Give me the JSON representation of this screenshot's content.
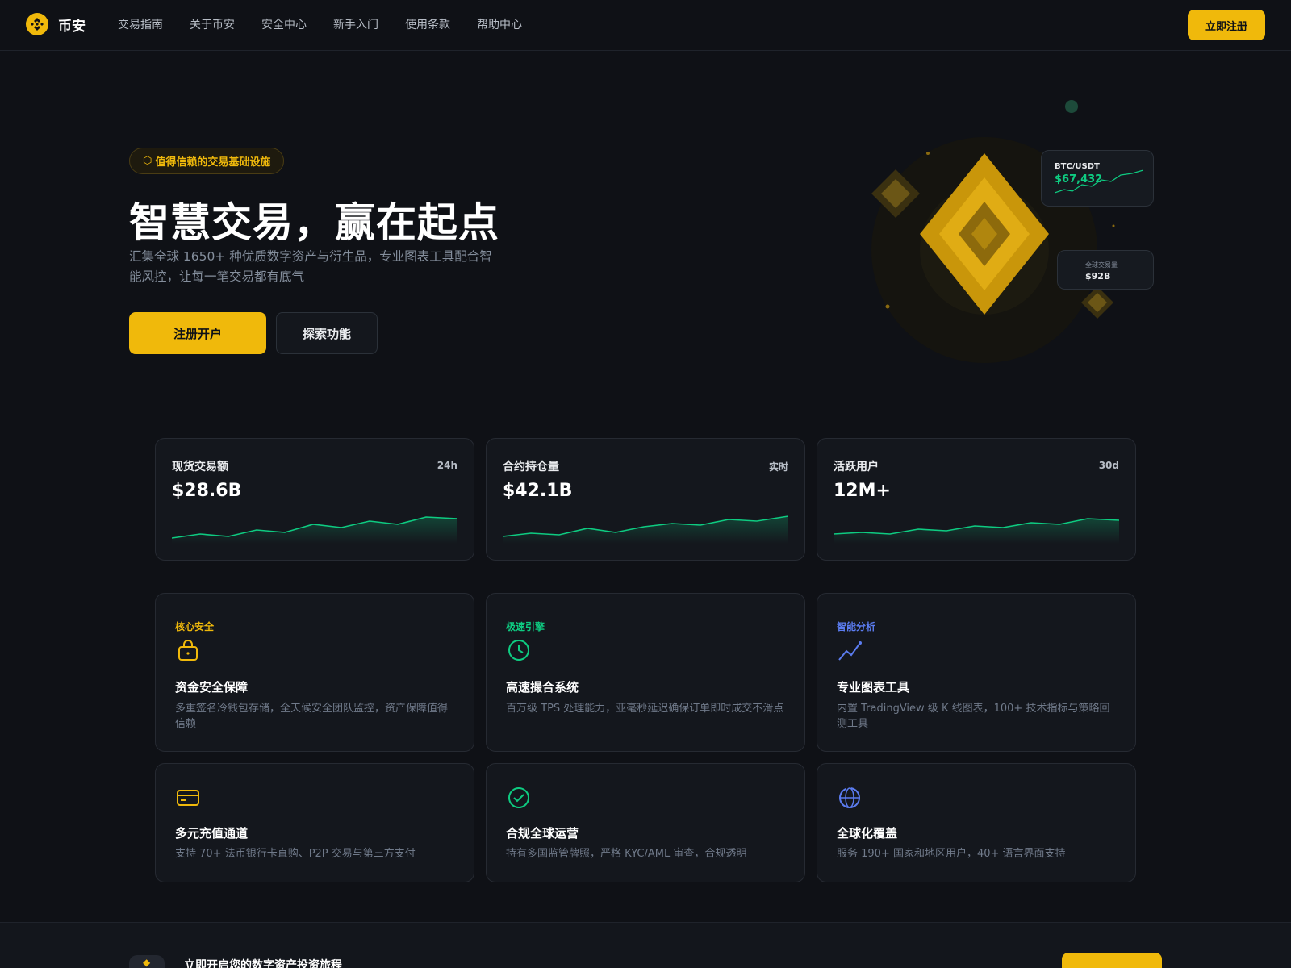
{
  "nav": {
    "brand": "币安",
    "links": [
      "交易指南",
      "关于币安",
      "安全中心",
      "新手入门",
      "使用条款",
      "帮助中心"
    ],
    "cta": "立即注册"
  },
  "hero": {
    "badge": "值得信赖的交易基础设施",
    "title": "智慧交易，赢在起点",
    "subtitle": "汇集全球 1650+ 种优质数字资产与衍生品，专业图表工具配合智能风控，让每一笔交易都有底气",
    "primary_button": "注册开户",
    "secondary_button": "探索功能",
    "price_card": {
      "pair": "BTC/USDT",
      "price": "$67,432"
    },
    "volume_card": {
      "label": "全球交易量",
      "value": "$92B"
    }
  },
  "stats": [
    {
      "label": "现货交易额",
      "period": "24h",
      "value": "$28.6B"
    },
    {
      "label": "合约持仓量",
      "period": "实时",
      "value": "$42.1B"
    },
    {
      "label": "活跃用户",
      "period": "30d",
      "value": "12M+"
    }
  ],
  "features": [
    {
      "tag": "核心安全",
      "title": "资金安全保障",
      "desc": "多重签名冷钱包存储，全天候安全团队监控，资产保障值得信赖",
      "icon": "lock-icon"
    },
    {
      "tag": "极速引擎",
      "title": "高速撮合系统",
      "desc": "百万级 TPS 处理能力，亚毫秒延迟确保订单即时成交不滑点",
      "icon": "clock-icon"
    },
    {
      "tag": "智能分析",
      "title": "专业图表工具",
      "desc": "内置 TradingView 级 K 线图表，100+ 技术指标与策略回测工具",
      "icon": "trend-chart-icon"
    },
    {
      "title": "多元充值通道",
      "desc": "支持 70+ 法币银行卡直购、P2P 交易与第三方支付",
      "icon": "card-icon"
    },
    {
      "title": "合规全球运营",
      "desc": "持有多国监管牌照，严格 KYC/AML 审查，合规透明",
      "icon": "check-circle-icon"
    },
    {
      "title": "全球化覆盖",
      "desc": "服务 190+ 国家和地区用户，40+ 语言界面支持",
      "icon": "globe-icon"
    }
  ],
  "cta_band": {
    "text": "立即开启您的数字资产投资旅程"
  },
  "colors": {
    "accent": "#f0b90b",
    "positive": "#0ecb81",
    "info": "#5b7cf0",
    "background": "#0f1116"
  }
}
